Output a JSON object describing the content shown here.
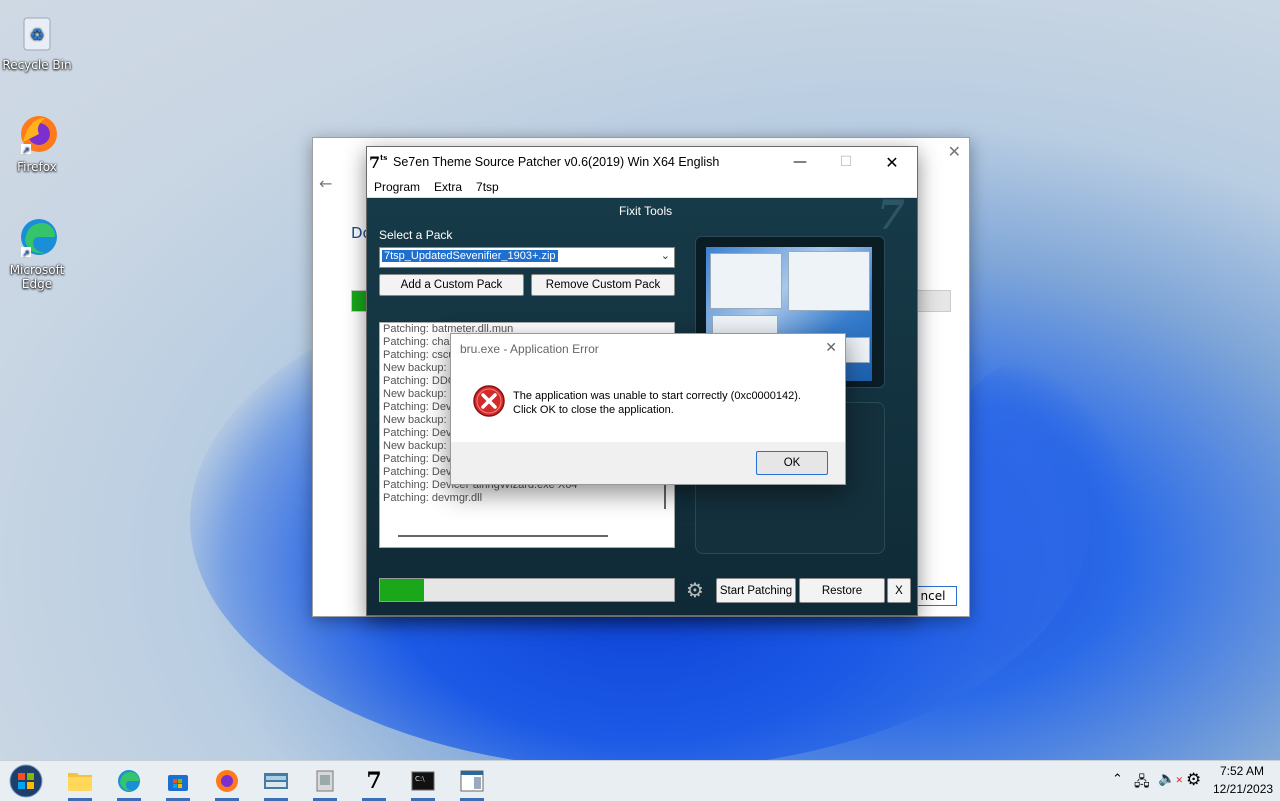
{
  "desktop": {
    "icons": [
      {
        "label": "Recycle Bin"
      },
      {
        "label": "Firefox"
      },
      {
        "label": "Microsoft Edge"
      }
    ]
  },
  "back_dialog": {
    "partial_text": "Do",
    "cancel_label": "ncel"
  },
  "main_window": {
    "title": "Se7en Theme Source Patcher v0.6(2019) Win X64 English",
    "menu": [
      "Program",
      "Extra",
      "7tsp"
    ],
    "section_title": "Fixit Tools",
    "select_label": "Select a Pack",
    "selected_pack": "7tsp_UpdatedSevenifier_1903+.zip",
    "buttons": {
      "add": "Add a Custom Pack",
      "remove": "Remove Custom Pack",
      "start": "Start Patching",
      "restore": "Restore",
      "x": "X"
    },
    "log_lines": [
      "Patching: batmeter.dll.mun",
      "Patching: char",
      "Patching: cscu",
      "New backup: l",
      "Patching: DDC",
      "New backup: l",
      "Patching: Devi",
      "New backup: l",
      "Patching: Devi",
      "New backup: l",
      "Patching: Devi",
      "Patching: Devi",
      "Patching: DevicePairingWizard.exe X64",
      "Patching: devmgr.dll"
    ],
    "progress": 0.15,
    "colors": {
      "progress": "#1aa81a",
      "body_bg": "#12303d"
    }
  },
  "error_dialog": {
    "title": "bru.exe - Application Error",
    "message_line1": "The application was unable to start correctly (0xc0000142).",
    "message_line2": "Click OK to close the application.",
    "ok_label": "OK"
  },
  "taskbar": {
    "time": "7:52 AM",
    "date": "12/21/2023"
  }
}
